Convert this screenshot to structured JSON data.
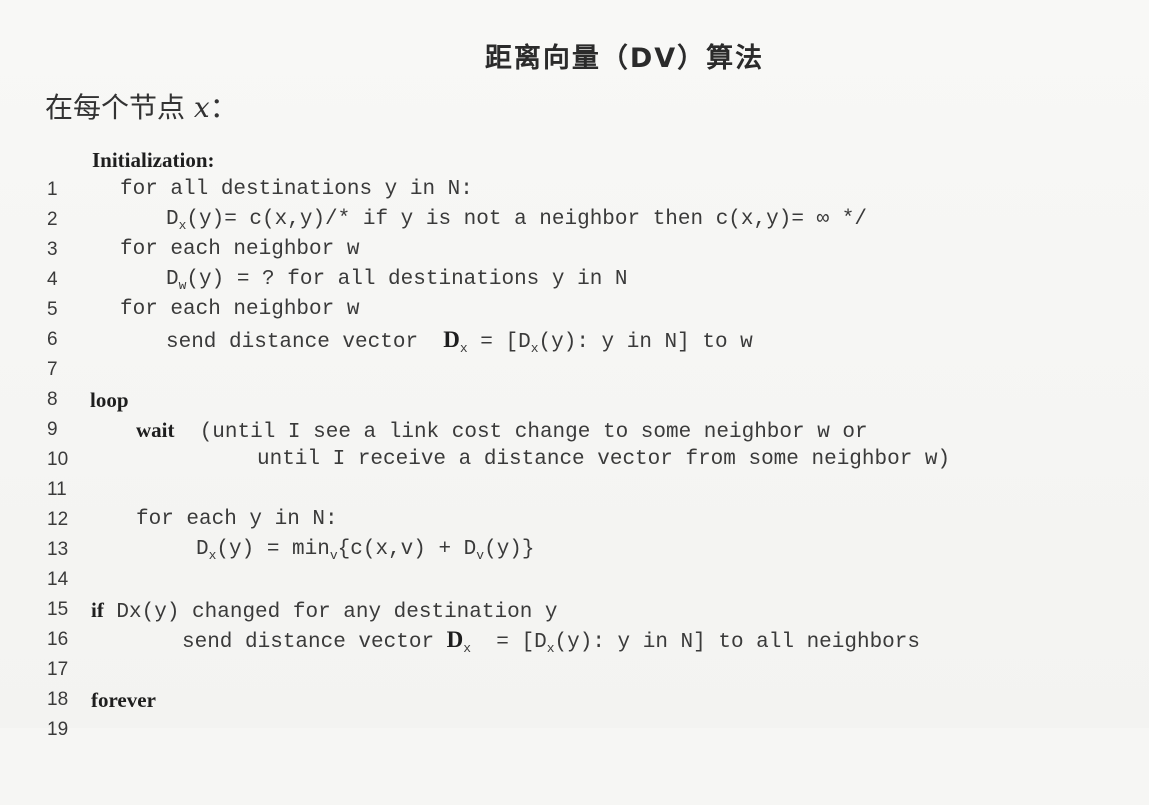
{
  "title": "距离向量（DV）算法",
  "subtitle": {
    "prefix": "在每个节点 ",
    "var": "x",
    "suffix": "："
  },
  "lines": [
    {
      "n": "1",
      "kw": "Initialization:"
    },
    {
      "n": "2",
      "text": "for all destinations y in N:"
    },
    {
      "n": "3",
      "a": "D",
      "sub": "x",
      "b": "(y)= c(x,y)/* if y is not a neighbor then c(x,y)= ∞ */"
    },
    {
      "n": "4",
      "text": "for each neighbor w"
    },
    {
      "n": "5",
      "a": "D",
      "sub": "w",
      "b": "(y) = ? for all destinations y in N"
    },
    {
      "n": "6",
      "text": "for each neighbor w"
    },
    {
      "n": "7",
      "a": "send distance vector  ",
      "bold": "D",
      "sub": "x",
      "b": " = [D",
      "sub2": "x",
      "c": "(y): y in N] to w"
    },
    {
      "n": "8"
    },
    {
      "n": "9",
      "kw": "loop"
    },
    {
      "n": "10",
      "kw": "wait",
      "b": "  (until I see a link cost change to some neighbor w or"
    },
    {
      "n": "11",
      "text": "until I receive a distance vector from some neighbor w)"
    },
    {
      "n": "12"
    },
    {
      "n": "13",
      "text": "for each y in N:"
    },
    {
      "n": "14",
      "a": "D",
      "sub": "x",
      "b": "(y) = min",
      "sub2": "v",
      "c": "{c(x,v) + D",
      "sub3": "v",
      "d": "(y)}"
    },
    {
      "n": "15"
    },
    {
      "n": "16",
      "kw": "if",
      "b": " Dx(y) changed for any destination y"
    },
    {
      "n": "17",
      "a": "send distance vector ",
      "bold": "D",
      "sub": "x",
      "b": "  = [D",
      "sub2": "x",
      "c": "(y): y in N] to all neighbors"
    },
    {
      "n": "18"
    },
    {
      "n": "19",
      "kw": "forever"
    }
  ]
}
